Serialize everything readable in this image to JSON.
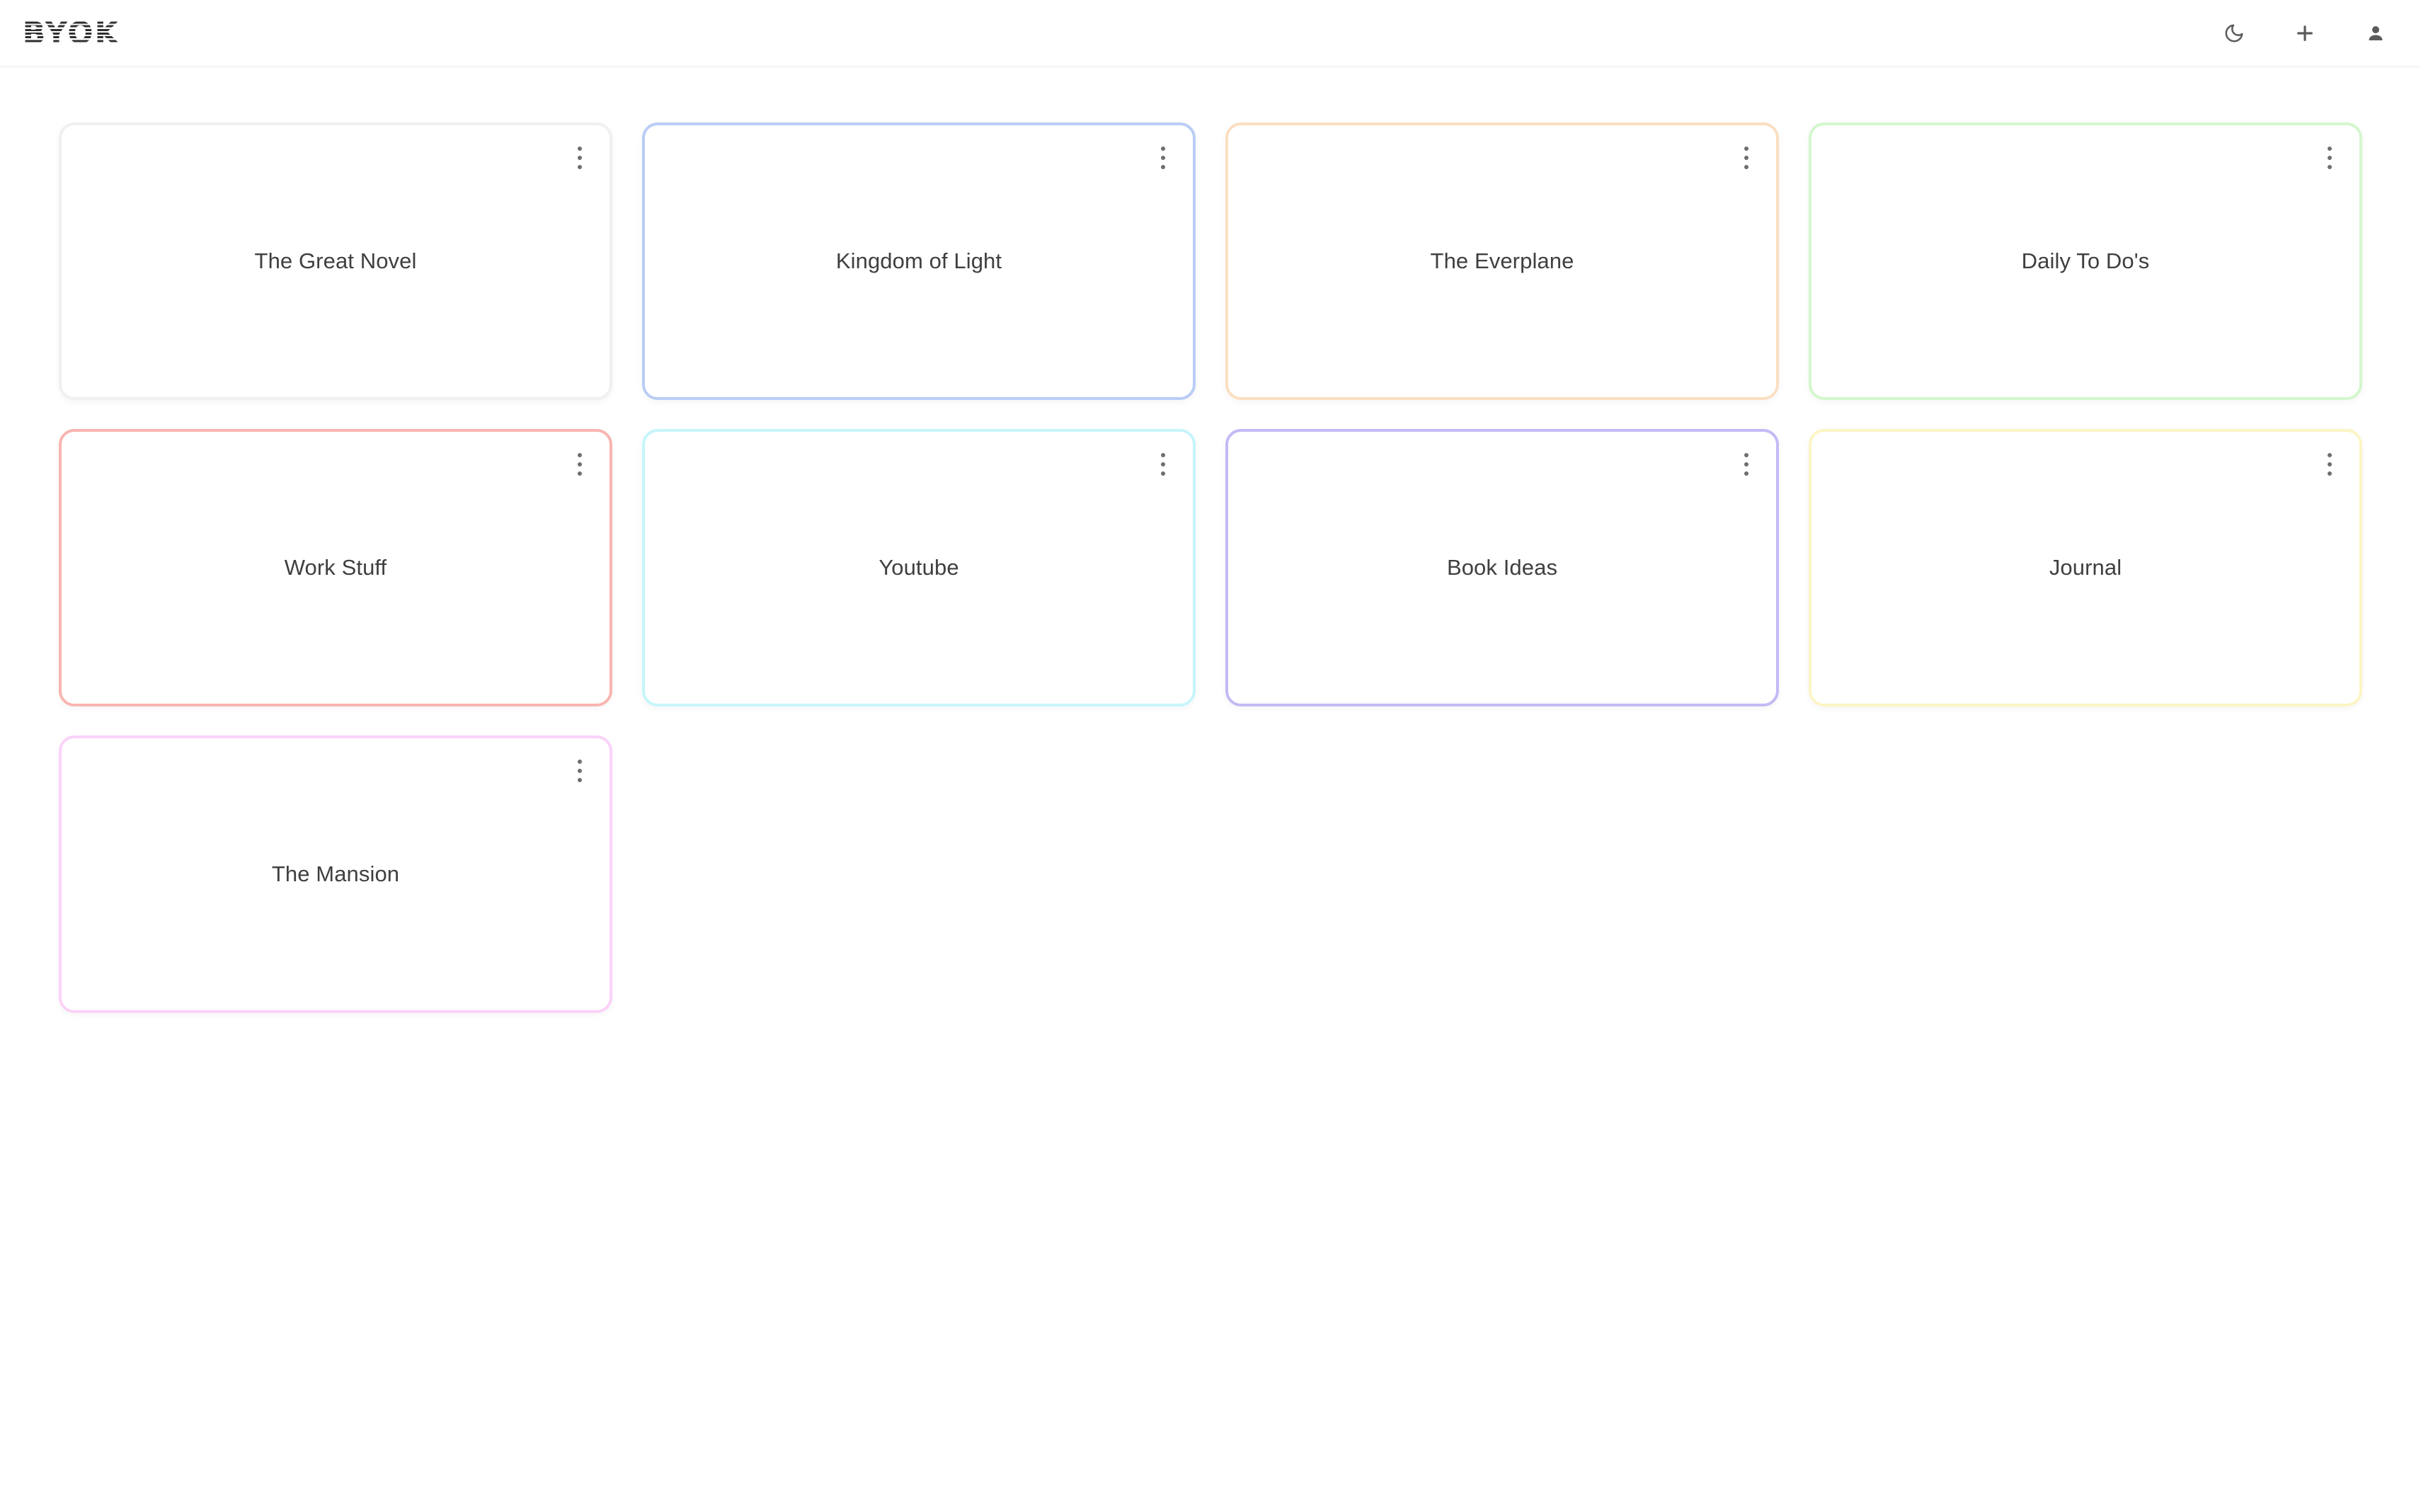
{
  "header": {
    "brand": "BYOK",
    "actions": [
      {
        "name": "dark-mode-toggle",
        "icon": "moon-icon",
        "label": "Toggle dark mode"
      },
      {
        "name": "add-notebook-button",
        "icon": "plus-icon",
        "label": "New notebook"
      },
      {
        "name": "account-button",
        "icon": "person-icon",
        "label": "Account"
      }
    ]
  },
  "board": {
    "menu_icon": "three-dot-vertical-icon",
    "cards": [
      {
        "title": "The Great Novel",
        "border_color": "#f0f0f0"
      },
      {
        "title": "Kingdom of Light",
        "border_color": "#b9cdf5"
      },
      {
        "title": "The Everplane",
        "border_color": "#fbdfc1"
      },
      {
        "title": "Daily To Do's",
        "border_color": "#d3f7cd"
      },
      {
        "title": "Work Stuff",
        "border_color": "#f9b5b1"
      },
      {
        "title": "Youtube",
        "border_color": "#c6f5fa"
      },
      {
        "title": "Book Ideas",
        "border_color": "#c5b9f5"
      },
      {
        "title": "Journal",
        "border_color": "#fcf5c5"
      },
      {
        "title": "The Mansion",
        "border_color": "#fad3f9"
      }
    ]
  }
}
